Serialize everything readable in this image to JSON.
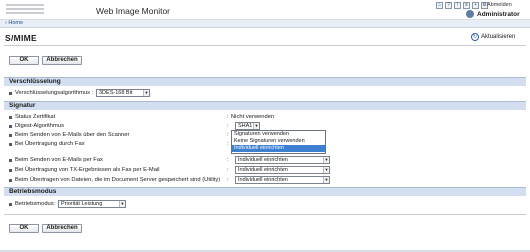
{
  "header": {
    "app_title": "Web Image Monitor",
    "logout": "Abmelden",
    "user": "Administrator"
  },
  "breadcrumb": {
    "home": "Home"
  },
  "page": {
    "title": "S/MIME",
    "refresh": "Aktualisieren"
  },
  "buttons": {
    "ok": "OK",
    "cancel": "Abbrechen"
  },
  "sections": {
    "encryption": "Verschlüsselung",
    "signature": "Signatur",
    "operation": "Betriebsmodus"
  },
  "encryption": {
    "algo_label": "Verschlüsselungsalgorithmus",
    "algo_value": "3DES-168 Bit"
  },
  "signature": {
    "rows": [
      {
        "label": "Status Zertifikat",
        "value": "Nicht verwenden"
      },
      {
        "label": "Digest-Algorithmus",
        "value": "SHA1"
      },
      {
        "label": "Beim Senden von E-Mails über den Scanner",
        "value": "Individuell einrichten"
      },
      {
        "label": "Bei Übertragung durch Fax",
        "value": "Individuell einrichten"
      },
      {
        "label": "Beim Senden von E-Mails per Fax",
        "value": "Individuell einrichten"
      },
      {
        "label": "Bei Übertragung von TX-Ergebnissen als Fax per E-Mail",
        "value": "Individuell einrichten"
      },
      {
        "label": "Beim Übertragen von Dateien, die im Document Server gespeichert sind (Utility)",
        "value": "Individuell einrichten"
      }
    ],
    "dropdown_options": [
      "Signaturen verwenden",
      "Keine Signaturen verwenden",
      "Individuell einrichten"
    ],
    "dropdown_selected": "Individuell einrichten"
  },
  "operation": {
    "label": "Betriebsmodus",
    "value": "Priorität Leistung"
  }
}
